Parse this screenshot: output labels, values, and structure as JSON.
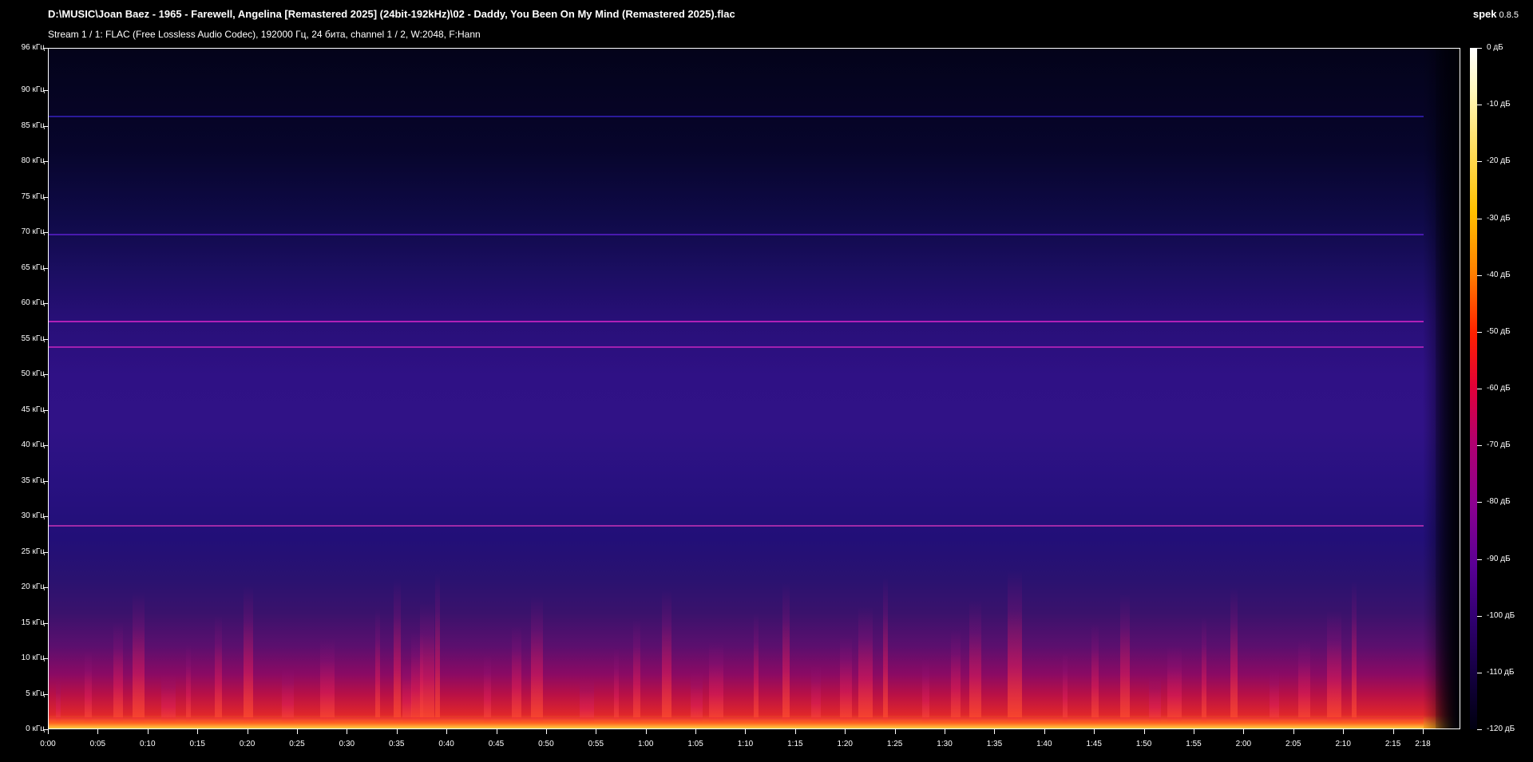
{
  "window": {
    "title": "D:\\MUSIC\\Joan Baez - 1965 - Farewell, Angelina [Remastered 2025] (24bit-192kHz)\\02 - Daddy, You Been On My Mind (Remastered 2025).flac",
    "stream_info": "Stream 1 / 1: FLAC (Free Lossless Audio Codec), 192000 Гц, 24 бита, channel 1 / 2, W:2048, F:Hann"
  },
  "brand": {
    "name": "spek",
    "version": "0.8.5"
  },
  "spectrogram": {
    "frequency_axis": {
      "unit": "кГц",
      "min": 0,
      "max": 96,
      "ticks": [
        "96 кГц",
        "90 кГц",
        "85 кГц",
        "80 кГц",
        "75 кГц",
        "70 кГц",
        "65 кГц",
        "60 кГц",
        "55 кГц",
        "50 кГц",
        "45 кГц",
        "40 кГц",
        "35 кГц",
        "30 кГц",
        "25 кГц",
        "20 кГц",
        "15 кГц",
        "10 кГц",
        "5 кГц",
        "0 кГц"
      ],
      "tick_values": [
        96,
        90,
        85,
        80,
        75,
        70,
        65,
        60,
        55,
        50,
        45,
        40,
        35,
        30,
        25,
        20,
        15,
        10,
        5,
        0
      ]
    },
    "time_axis": {
      "duration_seconds": 138,
      "ticks": [
        "0:00",
        "0:05",
        "0:10",
        "0:15",
        "0:20",
        "0:25",
        "0:30",
        "0:35",
        "0:40",
        "0:45",
        "0:50",
        "0:55",
        "1:00",
        "1:05",
        "1:10",
        "1:15",
        "1:20",
        "1:25",
        "1:30",
        "1:35",
        "1:40",
        "1:45",
        "1:50",
        "1:55",
        "2:00",
        "2:05",
        "2:10",
        "2:15",
        "2:18"
      ],
      "tick_seconds": [
        0,
        5,
        10,
        15,
        20,
        25,
        30,
        35,
        40,
        45,
        50,
        55,
        60,
        65,
        70,
        75,
        80,
        85,
        90,
        95,
        100,
        105,
        110,
        115,
        120,
        125,
        130,
        135,
        138
      ]
    },
    "tone_lines_khz": [
      {
        "freq": 86.4,
        "color": "#2a1a9a"
      },
      {
        "freq": 69.8,
        "color": "#4a1ab0"
      },
      {
        "freq": 57.6,
        "color": "#b020b8"
      },
      {
        "freq": 54.0,
        "color": "#a020b0"
      },
      {
        "freq": 28.8,
        "color": "#a02aa8"
      }
    ],
    "bursts_seconds": [
      1,
      4,
      7,
      9,
      12,
      14,
      17,
      20,
      24,
      28,
      33,
      35,
      36,
      37,
      38,
      39,
      44,
      47,
      49,
      54,
      57,
      59,
      62,
      65,
      67,
      71,
      74,
      77,
      80,
      82,
      84,
      88,
      91,
      93,
      97,
      102,
      105,
      108,
      111,
      113,
      116,
      119,
      123,
      126,
      129,
      131
    ]
  },
  "colorbar": {
    "unit": "дБ",
    "ticks": [
      "0 дБ",
      "-10 дБ",
      "-20 дБ",
      "-30 дБ",
      "-40 дБ",
      "-50 дБ",
      "-60 дБ",
      "-70 дБ",
      "-80 дБ",
      "-90 дБ",
      "-100 дБ",
      "-110 дБ",
      "-120 дБ"
    ],
    "tick_values": [
      0,
      -10,
      -20,
      -30,
      -40,
      -50,
      -60,
      -70,
      -80,
      -90,
      -100,
      -110,
      -120
    ]
  }
}
